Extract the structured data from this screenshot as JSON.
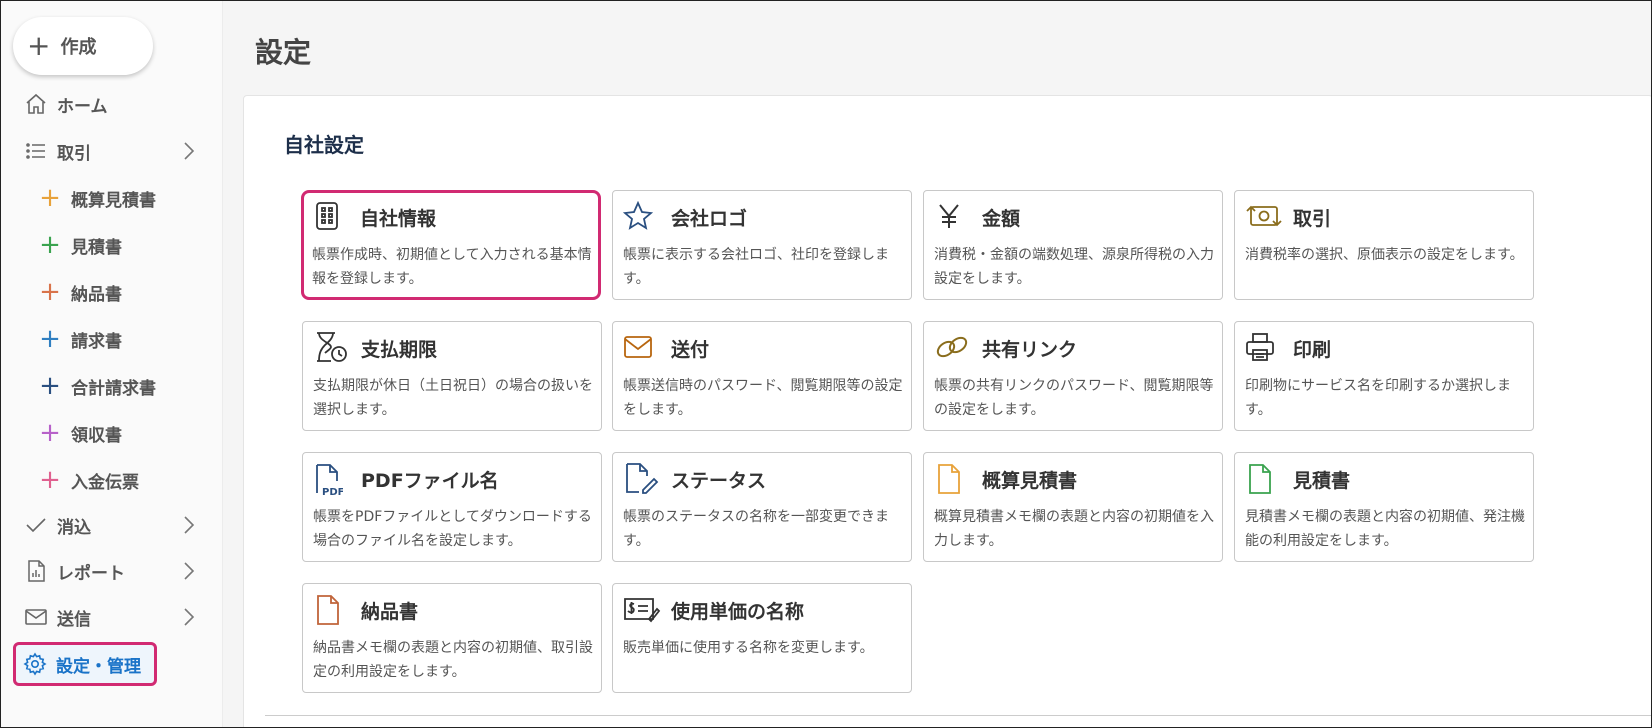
{
  "page": {
    "title": "設定"
  },
  "sidebar": {
    "create_label": "作成",
    "items": [
      {
        "label": "ホーム",
        "icon": "home-icon"
      },
      {
        "label": "取引",
        "icon": "list-icon"
      },
      {
        "label": "消込",
        "icon": "check-icon"
      },
      {
        "label": "レポート",
        "icon": "report-icon"
      },
      {
        "label": "送信",
        "icon": "mail-icon"
      },
      {
        "label": "設定・管理",
        "icon": "gear-icon"
      }
    ],
    "sub_items": [
      {
        "label": "概算見積書",
        "color": "#e8a23a"
      },
      {
        "label": "見積書",
        "color": "#3aa34f"
      },
      {
        "label": "納品書",
        "color": "#d9734a"
      },
      {
        "label": "請求書",
        "color": "#2f7fc1"
      },
      {
        "label": "合計請求書",
        "color": "#2a4f80"
      },
      {
        "label": "領収書",
        "color": "#b761c9"
      },
      {
        "label": "入金伝票",
        "color": "#e0608f"
      }
    ],
    "active_color": "#1a73c8",
    "highlight_color": "#d12a72"
  },
  "section": {
    "title": "自社設定"
  },
  "cards": [
    {
      "title": "自社情報",
      "desc": "帳票作成時、初期値として入力される基本情報を登録します。",
      "icon": "building-icon"
    },
    {
      "title": "会社ロゴ",
      "desc": "帳票に表示する会社ロゴ、社印を登録します。",
      "icon": "star-icon"
    },
    {
      "title": "金額",
      "desc": "消費税・金額の端数処理、源泉所得税の入力設定をします。",
      "icon": "yen-icon"
    },
    {
      "title": "取引",
      "desc": "消費税率の選択、原価表示の設定をします。",
      "icon": "exchange-icon"
    },
    {
      "title": "支払期限",
      "desc": "支払期限が休日（土日祝日）の場合の扱いを選択します。",
      "icon": "hourglass-clock-icon"
    },
    {
      "title": "送付",
      "desc": "帳票送信時のパスワード、閲覧期限等の設定をします。",
      "icon": "envelope-icon"
    },
    {
      "title": "共有リンク",
      "desc": "帳票の共有リンクのパスワード、閲覧期限等の設定をします。",
      "icon": "link-icon"
    },
    {
      "title": "印刷",
      "desc": "印刷物にサービス名を印刷するか選択します。",
      "icon": "printer-icon"
    },
    {
      "title": "PDFファイル名",
      "desc": "帳票をPDFファイルとしてダウンロードする場合のファイル名を設定します。",
      "icon": "pdf-file-icon",
      "icon_text": "PDF"
    },
    {
      "title": "ステータス",
      "desc": "帳票のステータスの名称を一部変更できます。",
      "icon": "file-edit-icon"
    },
    {
      "title": "概算見積書",
      "desc": "概算見積書メモ欄の表題と内容の初期値を入力します。",
      "icon": "file-orange-icon"
    },
    {
      "title": "見積書",
      "desc": "見積書メモ欄の表題と内容の初期値、発注機能の利用設定をします。",
      "icon": "file-green-icon"
    },
    {
      "title": "納品書",
      "desc": "納品書メモ欄の表題と内容の初期値、取引設定の利用設定をします。",
      "icon": "file-brown-icon"
    },
    {
      "title": "使用単価の名称",
      "desc": "販売単価に使用する名称を変更します。",
      "icon": "price-tag-icon"
    }
  ]
}
